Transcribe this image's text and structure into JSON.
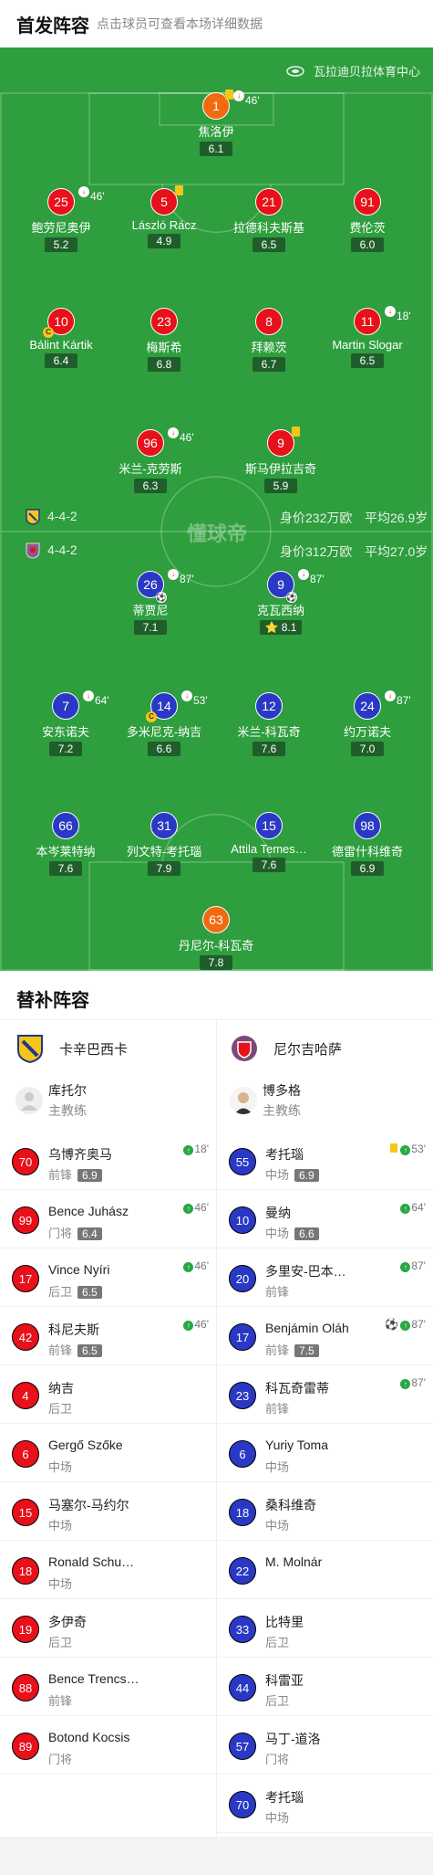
{
  "header": {
    "title": "首发阵容",
    "subtitle": "点击球员可查看本场详细数据"
  },
  "venue": "瓦拉迪贝拉体育中心",
  "watermark": "懂球帝",
  "home_info": {
    "formation": "4-4-2",
    "value": "身价232万欧",
    "age": "平均26.9岁"
  },
  "away_info": {
    "formation": "4-4-2",
    "value": "身价312万欧",
    "age": "平均27.0岁"
  },
  "home_players": [
    {
      "num": "1",
      "name": "焦洛伊",
      "rating": "6.1",
      "color": "orange",
      "sub": "46'"
    },
    {
      "num": "25",
      "name": "鲍劳尼奥伊",
      "rating": "5.2",
      "color": "red",
      "sub": "46'"
    },
    {
      "num": "5",
      "name": "László Rácz",
      "rating": "4.9",
      "color": "red"
    },
    {
      "num": "21",
      "name": "拉德科夫斯基",
      "rating": "6.5",
      "color": "red"
    },
    {
      "num": "91",
      "name": "费伦茨",
      "rating": "6.0",
      "color": "red"
    },
    {
      "num": "10",
      "name": "Bálint Kártik",
      "rating": "6.4",
      "color": "red"
    },
    {
      "num": "23",
      "name": "梅斯希",
      "rating": "6.8",
      "color": "red"
    },
    {
      "num": "8",
      "name": "拜赖茨",
      "rating": "6.7",
      "color": "red"
    },
    {
      "num": "11",
      "name": "Martin Slogar",
      "rating": "6.5",
      "color": "red",
      "sub": "18'"
    },
    {
      "num": "96",
      "name": "米兰-克劳斯",
      "rating": "6.3",
      "color": "red",
      "sub": "46'"
    },
    {
      "num": "9",
      "name": "斯马伊拉吉奇",
      "rating": "5.9",
      "color": "red"
    }
  ],
  "away_players": [
    {
      "num": "26",
      "name": "蒂贾尼",
      "rating": "7.1",
      "color": "blue",
      "sub": "87'"
    },
    {
      "num": "9",
      "name": "克瓦西纳",
      "rating": "8.1",
      "color": "blue",
      "sub": "87'",
      "star": "⭐"
    },
    {
      "num": "7",
      "name": "安东诺夫",
      "rating": "7.2",
      "color": "blue",
      "sub": "64'"
    },
    {
      "num": "14",
      "name": "多米尼克-纳吉",
      "rating": "6.6",
      "color": "blue",
      "sub": "53'"
    },
    {
      "num": "12",
      "name": "米兰-科瓦奇",
      "rating": "7.6",
      "color": "blue"
    },
    {
      "num": "24",
      "name": "约万诺夫",
      "rating": "7.0",
      "color": "blue",
      "sub": "87'"
    },
    {
      "num": "66",
      "name": "本岑莱特纳",
      "rating": "7.6",
      "color": "blue"
    },
    {
      "num": "31",
      "name": "列文特-考托瑙",
      "rating": "7.9",
      "color": "blue"
    },
    {
      "num": "15",
      "name": "Attila Temes…",
      "rating": "7.6",
      "color": "blue"
    },
    {
      "num": "98",
      "name": "德雷什科维奇",
      "rating": "6.9",
      "color": "blue"
    },
    {
      "num": "63",
      "name": "丹尼尔-科瓦奇",
      "rating": "7.8",
      "color": "orange"
    }
  ],
  "subs_title": "替补阵容",
  "home_team": {
    "name": "卡辛巴西卡",
    "coach": "库托尔",
    "coach_role": "主教练"
  },
  "away_team": {
    "name": "尼尔吉哈萨",
    "coach": "博多格",
    "coach_role": "主教练"
  },
  "home_subs": [
    {
      "num": "70",
      "name": "乌博齐奥马",
      "pos": "前锋",
      "rating": "6.9",
      "ev": "18'"
    },
    {
      "num": "99",
      "name": "Bence Juhász",
      "pos": "门将",
      "rating": "6.4",
      "ev": "46'"
    },
    {
      "num": "17",
      "name": "Vince Nyíri",
      "pos": "后卫",
      "rating": "6.5",
      "ev": "46'"
    },
    {
      "num": "42",
      "name": "科尼夫斯",
      "pos": "前锋",
      "rating": "6.5",
      "ev": "46'"
    },
    {
      "num": "4",
      "name": "纳吉",
      "pos": "后卫"
    },
    {
      "num": "6",
      "name": "Gergő Szőke",
      "pos": "中场"
    },
    {
      "num": "15",
      "name": "马塞尔-马约尔",
      "pos": "中场"
    },
    {
      "num": "18",
      "name": "Ronald Schu…",
      "pos": "中场"
    },
    {
      "num": "19",
      "name": "多伊奇",
      "pos": "后卫"
    },
    {
      "num": "88",
      "name": "Bence Trencs…",
      "pos": "前锋"
    },
    {
      "num": "89",
      "name": "Botond Kocsis",
      "pos": "门将"
    }
  ],
  "away_subs": [
    {
      "num": "55",
      "name": "考托瑙",
      "pos": "中场",
      "rating": "6.9",
      "ev": "53'",
      "card": true
    },
    {
      "num": "10",
      "name": "曼纳",
      "pos": "中场",
      "rating": "6.6",
      "ev": "64'"
    },
    {
      "num": "20",
      "name": "多里安-巴本…",
      "pos": "前锋",
      "ev": "87'"
    },
    {
      "num": "17",
      "name": "Benjámin Oláh",
      "pos": "前锋",
      "rating": "7.5",
      "ev": "87'",
      "goal": true
    },
    {
      "num": "23",
      "name": "科瓦奇雷蒂",
      "pos": "前锋",
      "ev": "87'"
    },
    {
      "num": "6",
      "name": "Yuriy Toma",
      "pos": "中场"
    },
    {
      "num": "18",
      "name": "桑科维奇",
      "pos": "中场"
    },
    {
      "num": "22",
      "name": "M. Molnár",
      "pos": ""
    },
    {
      "num": "33",
      "name": "比特里",
      "pos": "后卫"
    },
    {
      "num": "44",
      "name": "科雷亚",
      "pos": "后卫"
    },
    {
      "num": "57",
      "name": "马丁-道洛",
      "pos": "门将"
    },
    {
      "num": "70",
      "name": "考托瑙",
      "pos": "中场"
    }
  ]
}
